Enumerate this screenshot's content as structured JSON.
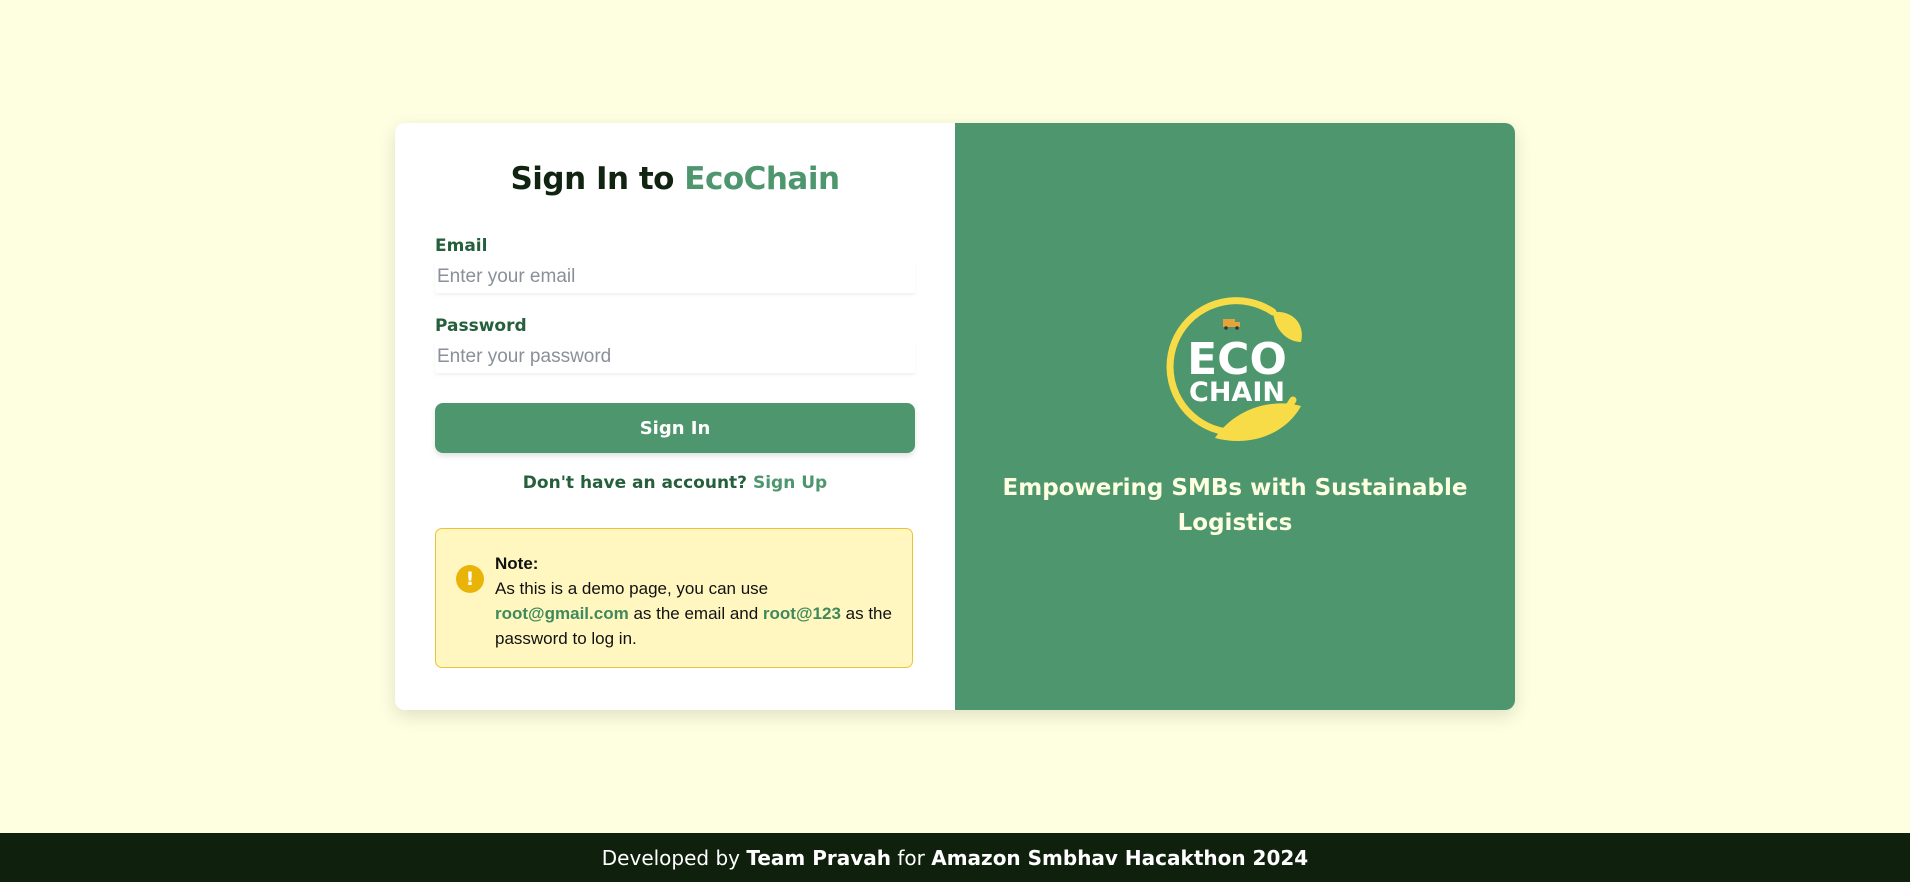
{
  "signin": {
    "title_prefix": "Sign In to",
    "title_brand": "EcoChain",
    "email_label": "Email",
    "email_placeholder": "Enter your email",
    "password_label": "Password",
    "password_placeholder": "Enter your password",
    "button_label": "Sign In",
    "no_account_text": "Don't have an account?",
    "signup_link": "Sign Up"
  },
  "note": {
    "title": "Note:",
    "text_1": "As this is a demo page, you can use",
    "demo_email": "root@gmail.com",
    "text_2": "as the email and",
    "demo_password": "root@123",
    "text_3": "as the password to log in."
  },
  "brand_panel": {
    "logo_line_1": "ECO",
    "logo_line_2": "CHAIN",
    "tagline_line_1": "Empowering SMBs with Sustainable",
    "tagline_line_2": "Logistics"
  },
  "footer": {
    "prefix": "Developed by",
    "team": "Team Pravah",
    "middle": "for",
    "event": "Amazon Smbhav Hacakthon 2024"
  },
  "colors": {
    "page_background": "#fefee0",
    "accent_green": "#4e966d",
    "dark_green": "#265f3c",
    "footer_background": "#0f200d",
    "note_background": "#fff7bf",
    "note_border": "#ebc33a",
    "logo_yellow": "#f7dc48"
  },
  "icons": {
    "note_icon": "exclamation-circle-icon",
    "logo_truck": "truck-icon",
    "logo_leaf": "leaf-icon"
  }
}
